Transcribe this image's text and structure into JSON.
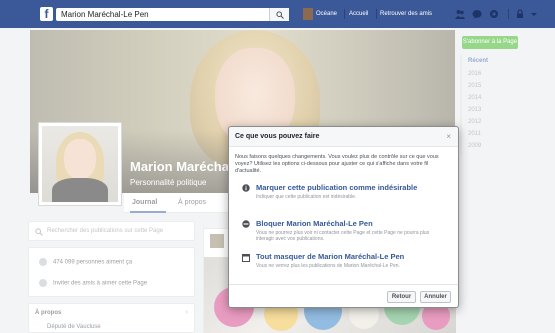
{
  "topbar": {
    "logo": "f",
    "search_value": "Marion Maréchal-Le Pen",
    "nav_user": "Océane",
    "nav_home": "Accueil",
    "nav_find_friends": "Retrouver des amis",
    "icons": [
      "friends-icon",
      "messages-icon",
      "notifications-icon",
      "privacy-icon",
      "menu-icon"
    ]
  },
  "profile": {
    "name": "Marion Maréchal",
    "category": "Personnalité politique"
  },
  "tabs": [
    {
      "label": "Journal",
      "active": true
    },
    {
      "label": "À propos",
      "active": false
    }
  ],
  "left_column": {
    "search_placeholder": "Rechercher des publications sur cette Page",
    "likes_text": "474 099 personnes aiment ça",
    "invite_text": "Inviter des amis à aimer cette Page",
    "about_header": "À propos",
    "about_line": "Député de Vaucluse"
  },
  "right_column": {
    "follow_button": "S'abonner à la Page",
    "years": [
      {
        "label": "Récent",
        "active": true
      },
      {
        "label": "2016",
        "active": false
      },
      {
        "label": "2015",
        "active": false
      },
      {
        "label": "2014",
        "active": false
      },
      {
        "label": "2013",
        "active": false
      },
      {
        "label": "2012",
        "active": false
      },
      {
        "label": "2011",
        "active": false
      },
      {
        "label": "2009",
        "active": false
      }
    ]
  },
  "dialog": {
    "title": "Ce que vous pouvez faire",
    "close": "×",
    "intro": "Nous faisons quelques changements. Vous voulez plus de contrôle sur ce que vous voyez? Utilisez les options ci-dessous pour ajuster ce qui s'affiche dans votre fil d'actualité.",
    "options": [
      {
        "icon": "info-icon",
        "title": "Marquer cette publication comme indésirable",
        "desc": "Indiquer que cette publication est indésirable."
      },
      {
        "icon": "block-icon",
        "title": "Bloquer Marion Maréchal-Le Pen",
        "desc": "Vous ne pourrez plus voir ni contacter cette Page et cette Page ne pourra plus interagir avec vos publications."
      },
      {
        "icon": "hide-all-icon",
        "title": "Tout masquer de Marion Maréchal-Le Pen",
        "desc": "Vous ne verrez plus les publications de Marion Maréchal-Le Pen."
      }
    ],
    "back_button": "Retour",
    "cancel_button": "Annuler"
  },
  "colors": {
    "brand": "#3b5998",
    "link": "#365899",
    "follow": "#42b72a"
  }
}
